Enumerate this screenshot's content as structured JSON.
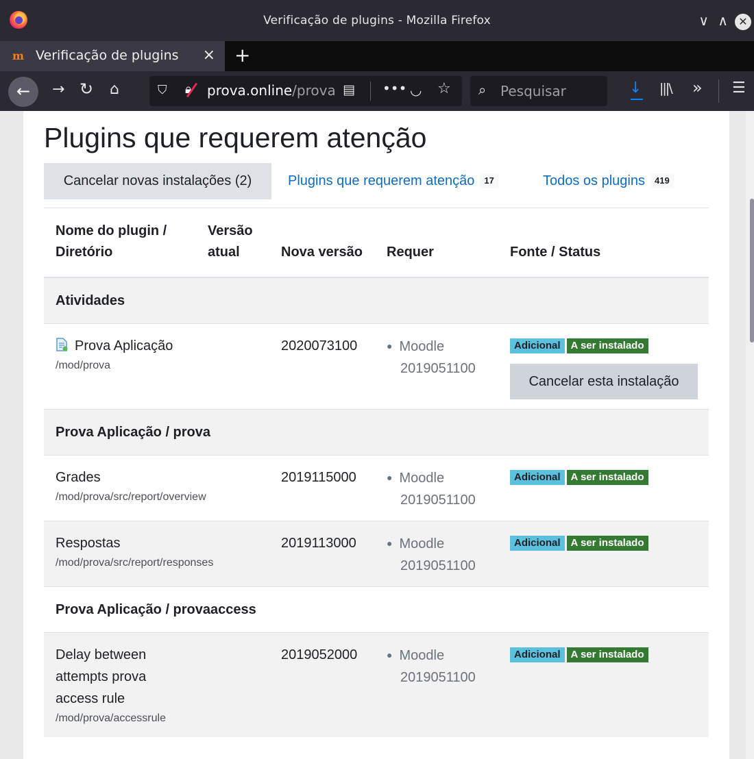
{
  "window": {
    "title": "Verificação de plugins - Mozilla Firefox",
    "controls": {
      "minimize": "∨",
      "maximize": "∧",
      "close": "✕"
    }
  },
  "tab": {
    "label": "Verificação de plugins",
    "close": "×",
    "favicon": "moodle-favicon",
    "new_tab": "+"
  },
  "navbar": {
    "url_host": "prova.online",
    "url_path": "/prova",
    "search_placeholder": "Pesquisar",
    "icons": [
      "back-icon",
      "forward-icon",
      "reload-icon",
      "home-icon",
      "shield-icon",
      "insecure-lock-icon",
      "reader-view-icon",
      "more-icon",
      "pocket-icon",
      "star-icon",
      "search-icon",
      "download-icon",
      "library-icon",
      "overflow-icon",
      "menu-icon"
    ]
  },
  "page": {
    "heading": "Plugins que requerem atenção",
    "tabs": [
      {
        "label": "Cancelar novas instalações (2)",
        "count": ""
      },
      {
        "label": "Plugins que requerem atenção",
        "count": "17"
      },
      {
        "label": "Todos os plugins",
        "count": "419"
      }
    ],
    "table": {
      "headers": [
        "Nome do plugin / Diretório",
        "Versão atual",
        "Nova versão",
        "Requer",
        "Fonte / Status"
      ],
      "rows": [
        {
          "group": "Atividades"
        },
        {
          "name": "Prova Aplicação",
          "path": "/mod/prova",
          "current": "",
          "new_version": "2020073100",
          "requires_label": "Moodle",
          "requires_version": "2019051100",
          "source": "Adicional",
          "status": "A ser instalado",
          "action": "Cancelar esta instalação"
        },
        {
          "group": "Prova Aplicação / prova"
        },
        {
          "name": "Grades",
          "path": "/mod/prova/src/report/overview",
          "current": "",
          "new_version": "2019115000",
          "requires_label": "Moodle",
          "requires_version": "2019051100",
          "source": "Adicional",
          "status": "A ser instalado"
        },
        {
          "name": "Respostas",
          "path": "/mod/prova/src/report/responses",
          "current": "",
          "new_version": "2019113000",
          "requires_label": "Moodle",
          "requires_version": "2019051100",
          "source": "Adicional",
          "status": "A ser instalado"
        },
        {
          "group": "Prova Aplicação / provaaccess"
        },
        {
          "name": "Delay between attempts prova access rule",
          "path": "/mod/prova/accessrule",
          "current": "",
          "new_version": "2019052000",
          "requires_label": "Moodle",
          "requires_version": "2019051100",
          "source": "Adicional",
          "status": "A ser instalado"
        }
      ]
    }
  },
  "colors": {
    "link": "#0f6cbf",
    "badge_info": "#5bc0de",
    "badge_success": "#357a32",
    "chrome_dark": "#2b2a33"
  }
}
